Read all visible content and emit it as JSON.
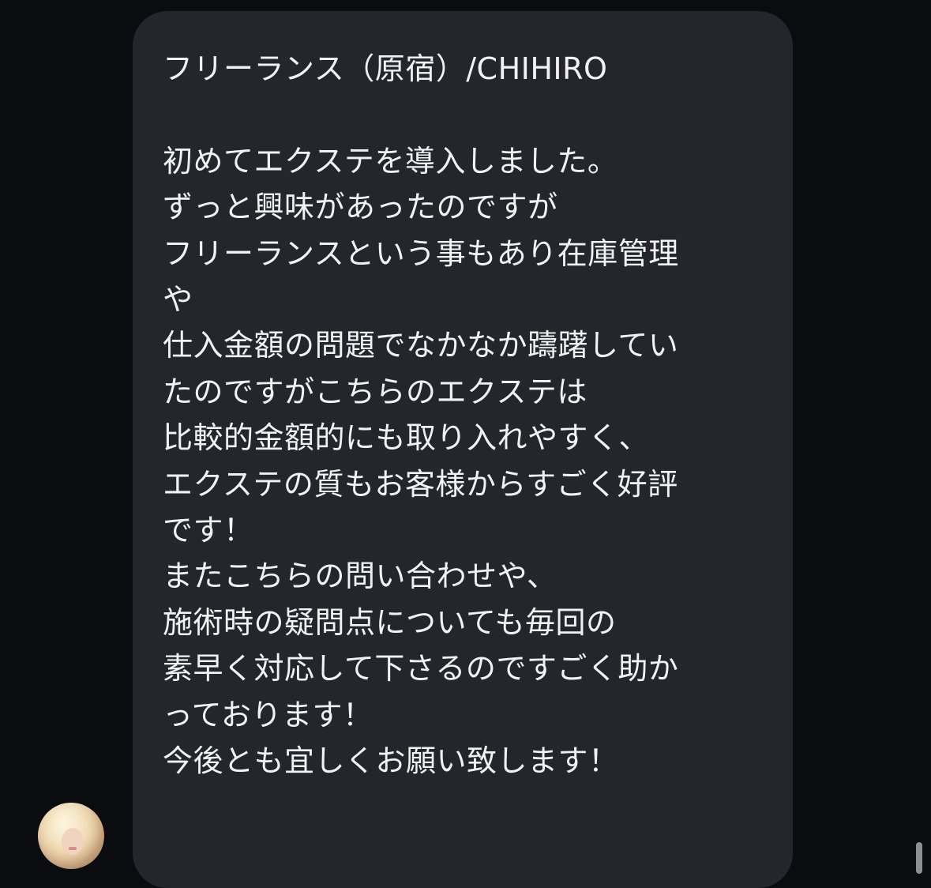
{
  "message": {
    "lines": [
      "フリーランス（原宿）/CHIHIRO",
      "",
      "初めてエクステを導入しました。",
      "ずっと興味があったのですが",
      "フリーランスという事もあり在庫管理",
      "や",
      "仕入金額の問題でなかなか躊躇してい",
      "たのですがこちらのエクステは",
      "比較的金額的にも取り入れやすく、",
      "エクステの質もお客様からすごく好評",
      "です！",
      "またこちらの問い合わせや、",
      "施術時の疑問点についても毎回の",
      "素早く対応して下さるのですごく助か",
      "っております！",
      "今後とも宜しくお願い致します！"
    ]
  }
}
